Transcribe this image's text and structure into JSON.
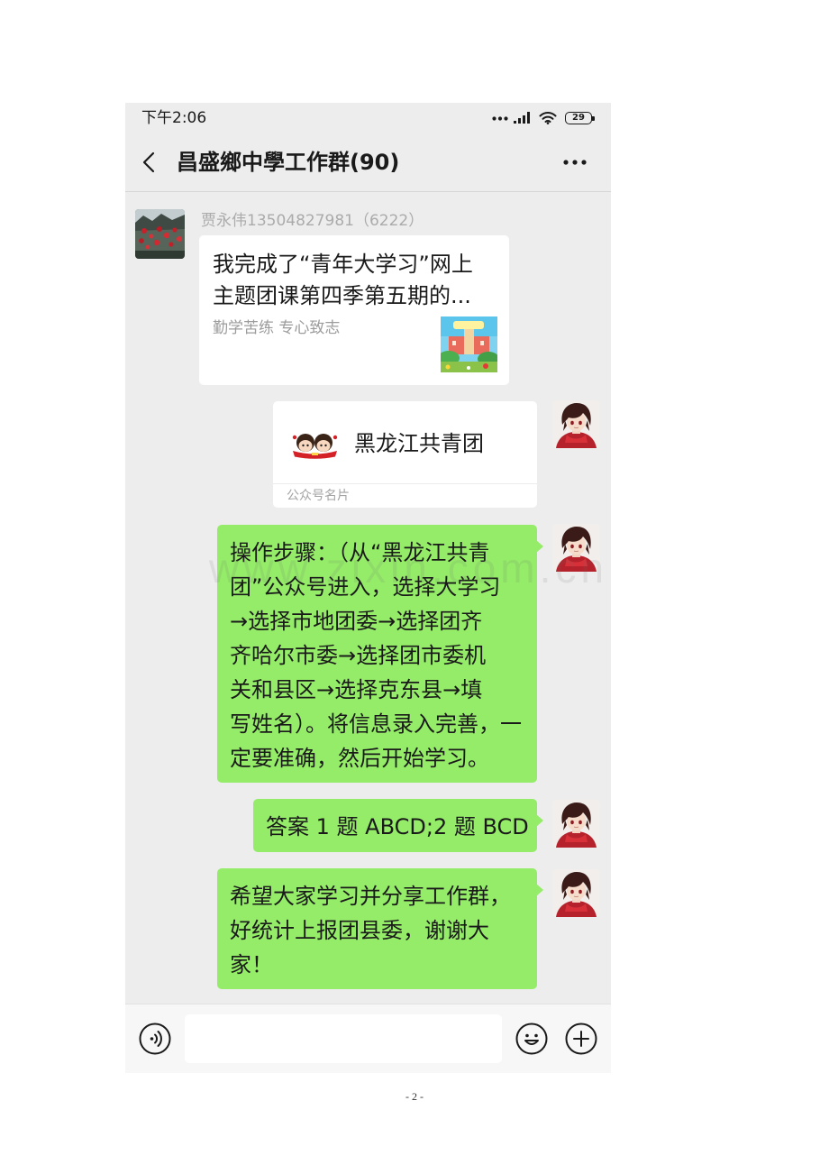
{
  "status_bar": {
    "time": "下午2:06",
    "battery_level": "29",
    "icons": {
      "notifications": "notification-dots-icon",
      "signal": "signal-icon",
      "wifi": "wifi-icon",
      "battery": "battery-icon"
    }
  },
  "header": {
    "title": "昌盛鄉中學工作群(90)",
    "icons": {
      "back": "chevron-left-icon",
      "more": "more-icon"
    }
  },
  "messages": [
    {
      "sender": "贾永伟13504827981（6222）",
      "title_lines": [
        "我完成了“青年大学习”网上",
        "主题团课第四季第五期的..."
      ],
      "description": "勤学苦练 专心致志"
    },
    {
      "card_name": "黑龙江共青团",
      "card_footer": "公众号名片"
    },
    {
      "lines": [
        "操作步骤：（从“黑龙江共青",
        "团”公众号进入，选择大学习",
        "→选择市地团委→选择团齐",
        "齐哈尔市委→选择团市委机",
        "关和县区→选择克东县→填",
        "写姓名）。将信息录入完善，一",
        "定要准确，然后开始学习。"
      ]
    },
    {
      "lines": [
        "答案 1 题 ABCD;2 题 BCD"
      ]
    },
    {
      "lines": [
        "希望大家学习并分享工作群，",
        "好统计上报团县委，谢谢大",
        "家！"
      ]
    }
  ],
  "composer": {
    "value": "",
    "icons": {
      "voice": "voice-icon",
      "emoji": "emoji-icon",
      "more": "plus-icon"
    }
  },
  "colors": {
    "page_background": "#ffffff",
    "chat_background": "#ededed",
    "outgoing_bubble": "#95ec69",
    "incoming_bubble": "#ffffff",
    "composer_background": "#f7f7f7"
  },
  "watermark": "www.zixin.com.cn",
  "page_number": "- 2 -"
}
